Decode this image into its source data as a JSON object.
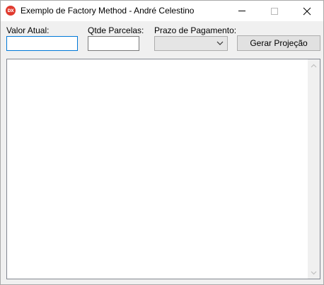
{
  "window": {
    "title": "Exemplo de Factory Method - André Celestino",
    "icon_label": "DX",
    "icon_color": "#e03a2e"
  },
  "form": {
    "valor_atual": {
      "label": "Valor Atual:",
      "value": ""
    },
    "qtde_parcelas": {
      "label": "Qtde Parcelas:",
      "value": ""
    },
    "prazo_pagamento": {
      "label": "Prazo de Pagamento:",
      "selected": ""
    },
    "gerar_button_label": "Gerar Projeção"
  },
  "output": {
    "text": ""
  },
  "colors": {
    "focus_border": "#0078d7",
    "window_bg": "#f0f0f0",
    "button_bg": "#e1e1e1"
  },
  "icons": {
    "minimize": "minimize-icon",
    "maximize": "maximize-icon",
    "close": "close-icon",
    "dropdown": "chevron-down-icon",
    "scroll_up": "scroll-up-icon",
    "scroll_down": "scroll-down-icon"
  }
}
